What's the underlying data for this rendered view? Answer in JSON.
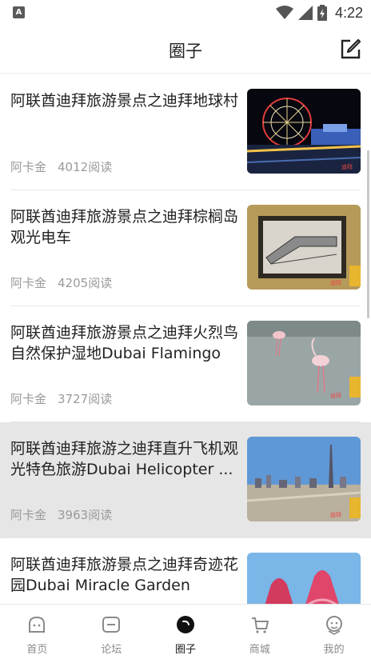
{
  "status_bar": {
    "notification_icon": "A",
    "time": "4:22"
  },
  "header": {
    "title": "圈子",
    "action_icon": "edit-icon"
  },
  "feed": [
    {
      "title": "阿联酋迪拜旅游景点之迪拜地球村",
      "author": "阿卡金",
      "reads": "4012阅读",
      "image": "night-amusement-park"
    },
    {
      "title": "阿联酋迪拜旅游景点之迪拜棕榈岛观光电车",
      "author": "阿卡金",
      "reads": "4205阅读",
      "image": "monorail-painting"
    },
    {
      "title": "阿联酋迪拜旅游景点之迪拜火烈鸟自然保护湿地Dubai Flamingo",
      "author": "阿卡金",
      "reads": "3727阅读",
      "image": "flamingos"
    },
    {
      "title": "阿联酋迪拜旅游之迪拜直升飞机观光特色旅游Dubai Helicopter ...",
      "author": "阿卡金",
      "reads": "3963阅读",
      "image": "dubai-skyline"
    },
    {
      "title": "阿联酋迪拜旅游景点之迪拜奇迹花园Dubai Miracle Garden",
      "author": "",
      "reads": "",
      "image": "flower-garden"
    }
  ],
  "tabs": [
    {
      "label": "首页",
      "icon": "home-icon"
    },
    {
      "label": "论坛",
      "icon": "forum-icon"
    },
    {
      "label": "圈子",
      "icon": "circle-icon"
    },
    {
      "label": "商城",
      "icon": "cart-icon"
    },
    {
      "label": "我的",
      "icon": "profile-icon"
    }
  ]
}
